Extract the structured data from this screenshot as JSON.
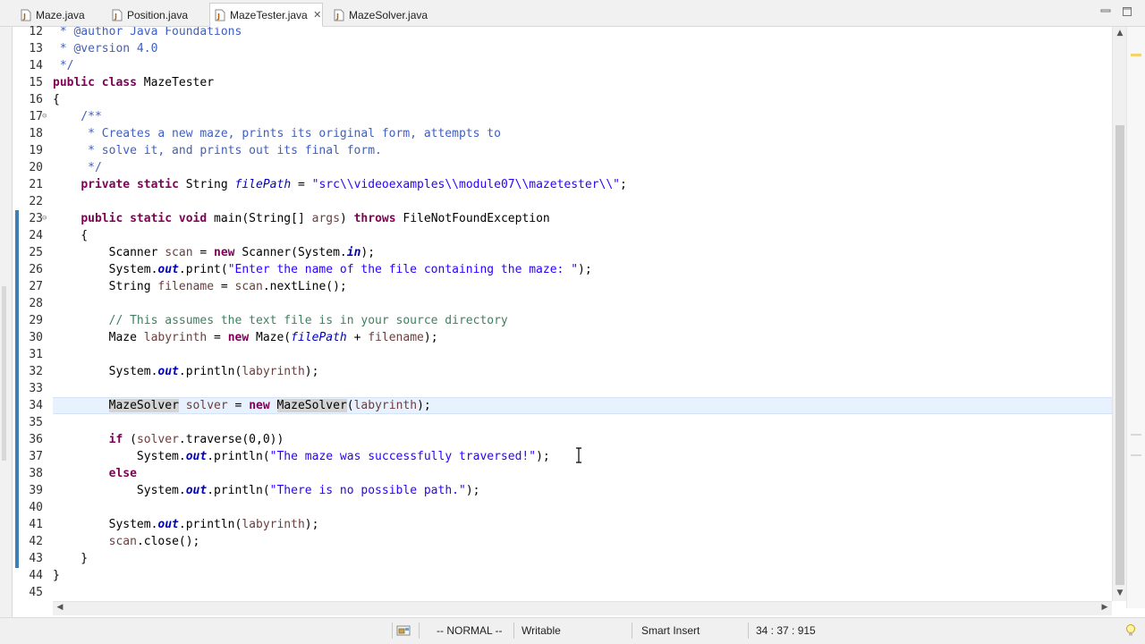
{
  "tabs": [
    {
      "label": "Maze.java",
      "active": false
    },
    {
      "label": "Position.java",
      "active": false
    },
    {
      "label": "MazeTester.java",
      "active": true
    },
    {
      "label": "MazeSolver.java",
      "active": false
    }
  ],
  "window_controls": {
    "minimize": "▭",
    "maximize": "□"
  },
  "editor": {
    "current_line": 34,
    "lines": [
      {
        "n": "12",
        "text": " * @author Java Foundations"
      },
      {
        "n": "13",
        "text": " * @version 4.0"
      },
      {
        "n": "14",
        "text": " */"
      },
      {
        "n": "15",
        "text": "public class MazeTester"
      },
      {
        "n": "16",
        "text": "{"
      },
      {
        "n": "17",
        "text": "    /**"
      },
      {
        "n": "18",
        "text": "     * Creates a new maze, prints its original form, attempts to"
      },
      {
        "n": "19",
        "text": "     * solve it, and prints out its final form."
      },
      {
        "n": "20",
        "text": "     */"
      },
      {
        "n": "21",
        "text": "    private static String filePath = \"src\\\\videoexamples\\\\module07\\\\mazetester\\\\\";"
      },
      {
        "n": "22",
        "text": ""
      },
      {
        "n": "23",
        "text": "    public static void main(String[] args) throws FileNotFoundException"
      },
      {
        "n": "24",
        "text": "    {"
      },
      {
        "n": "25",
        "text": "        Scanner scan = new Scanner(System.in);"
      },
      {
        "n": "26",
        "text": "        System.out.print(\"Enter the name of the file containing the maze: \");"
      },
      {
        "n": "27",
        "text": "        String filename = scan.nextLine();"
      },
      {
        "n": "28",
        "text": ""
      },
      {
        "n": "29",
        "text": "        // This assumes the text file is in your source directory"
      },
      {
        "n": "30",
        "text": "        Maze labyrinth = new Maze(filePath + filename);"
      },
      {
        "n": "31",
        "text": ""
      },
      {
        "n": "32",
        "text": "        System.out.println(labyrinth);"
      },
      {
        "n": "33",
        "text": ""
      },
      {
        "n": "34",
        "text": "        MazeSolver solver = new MazeSolver(labyrinth);"
      },
      {
        "n": "35",
        "text": ""
      },
      {
        "n": "36",
        "text": "        if (solver.traverse(0,0))"
      },
      {
        "n": "37",
        "text": "            System.out.println(\"The maze was successfully traversed!\");"
      },
      {
        "n": "38",
        "text": "        else"
      },
      {
        "n": "39",
        "text": "            System.out.println(\"There is no possible path.\");"
      },
      {
        "n": "40",
        "text": ""
      },
      {
        "n": "41",
        "text": "        System.out.println(labyrinth);"
      },
      {
        "n": "42",
        "text": "        scan.close();"
      },
      {
        "n": "43",
        "text": "    }"
      },
      {
        "n": "44",
        "text": "}"
      },
      {
        "n": "45",
        "text": ""
      }
    ]
  },
  "statusbar": {
    "mode": "-- NORMAL --",
    "writable": "Writable",
    "insert_mode": "Smart Insert",
    "position": "34 : 37 : 915"
  },
  "colors": {
    "keyword": "#7f0055",
    "comment": "#3f7f5f",
    "javadoc": "#3f5fbf",
    "string": "#2a00ff",
    "field": "#0000c0",
    "local_var": "#6a3e3e",
    "current_line": "#e8f2fe",
    "quick_diff": "#3e7fb5"
  },
  "icons": {
    "tab": "java-file-icon",
    "tab_close": "close-icon",
    "status_left": "readonly-lock-icon",
    "overview_top": "lightbulb-icon"
  }
}
